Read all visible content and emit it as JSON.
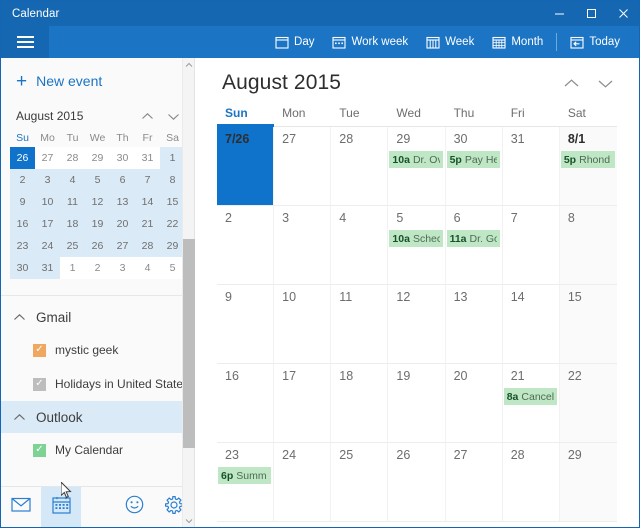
{
  "window": {
    "title": "Calendar",
    "controls": {
      "minimize": "minimize-icon",
      "maximize": "maximize-icon",
      "close": "close-icon"
    },
    "accent": "#1667b2",
    "command_bar_bg": "#1b74c4"
  },
  "command_bar": {
    "menu_icon": "hamburger-icon",
    "views": [
      {
        "label": "Day",
        "icon": "calendar-day-icon"
      },
      {
        "label": "Work week",
        "icon": "calendar-workweek-icon"
      },
      {
        "label": "Week",
        "icon": "calendar-week-icon"
      },
      {
        "label": "Month",
        "icon": "calendar-month-icon"
      }
    ],
    "today": {
      "label": "Today",
      "icon": "calendar-today-icon"
    }
  },
  "sidebar": {
    "new_event": {
      "label": "New event",
      "icon": "plus-icon"
    },
    "mini_calendar": {
      "title": "August 2015",
      "prev_icon": "chevron-up-icon",
      "next_icon": "chevron-down-icon",
      "day_headers": [
        "Su",
        "Mo",
        "Tu",
        "We",
        "Th",
        "Fr",
        "Sa"
      ],
      "weeks": [
        [
          {
            "d": "26",
            "in": false,
            "today": true
          },
          {
            "d": "27",
            "in": false,
            "today": false
          },
          {
            "d": "28",
            "in": false,
            "today": false
          },
          {
            "d": "29",
            "in": false,
            "today": false
          },
          {
            "d": "30",
            "in": false,
            "today": false
          },
          {
            "d": "31",
            "in": false,
            "today": false
          },
          {
            "d": "1",
            "in": true,
            "today": false
          }
        ],
        [
          {
            "d": "2",
            "in": true,
            "today": false
          },
          {
            "d": "3",
            "in": true,
            "today": false
          },
          {
            "d": "4",
            "in": true,
            "today": false
          },
          {
            "d": "5",
            "in": true,
            "today": false
          },
          {
            "d": "6",
            "in": true,
            "today": false
          },
          {
            "d": "7",
            "in": true,
            "today": false
          },
          {
            "d": "8",
            "in": true,
            "today": false
          }
        ],
        [
          {
            "d": "9",
            "in": true,
            "today": false
          },
          {
            "d": "10",
            "in": true,
            "today": false
          },
          {
            "d": "11",
            "in": true,
            "today": false
          },
          {
            "d": "12",
            "in": true,
            "today": false
          },
          {
            "d": "13",
            "in": true,
            "today": false
          },
          {
            "d": "14",
            "in": true,
            "today": false
          },
          {
            "d": "15",
            "in": true,
            "today": false
          }
        ],
        [
          {
            "d": "16",
            "in": true,
            "today": false
          },
          {
            "d": "17",
            "in": true,
            "today": false
          },
          {
            "d": "18",
            "in": true,
            "today": false
          },
          {
            "d": "19",
            "in": true,
            "today": false
          },
          {
            "d": "20",
            "in": true,
            "today": false
          },
          {
            "d": "21",
            "in": true,
            "today": false
          },
          {
            "d": "22",
            "in": true,
            "today": false
          }
        ],
        [
          {
            "d": "23",
            "in": true,
            "today": false
          },
          {
            "d": "24",
            "in": true,
            "today": false
          },
          {
            "d": "25",
            "in": true,
            "today": false
          },
          {
            "d": "26",
            "in": true,
            "today": false
          },
          {
            "d": "27",
            "in": true,
            "today": false
          },
          {
            "d": "28",
            "in": true,
            "today": false
          },
          {
            "d": "29",
            "in": true,
            "today": false
          }
        ],
        [
          {
            "d": "30",
            "in": true,
            "today": false
          },
          {
            "d": "31",
            "in": true,
            "today": false
          },
          {
            "d": "1",
            "in": false,
            "today": false
          },
          {
            "d": "2",
            "in": false,
            "today": false
          },
          {
            "d": "3",
            "in": false,
            "today": false
          },
          {
            "d": "4",
            "in": false,
            "today": false
          },
          {
            "d": "5",
            "in": false,
            "today": false
          }
        ]
      ]
    },
    "accounts": [
      {
        "name": "Gmail",
        "hovered": false,
        "calendars": [
          {
            "label": "mystic geek",
            "checked": true,
            "color": "#f0a860",
            "swatch": "orange"
          },
          {
            "label": "Holidays in United States",
            "checked": true,
            "color": "#bdbdbd",
            "swatch": "gray"
          }
        ]
      },
      {
        "name": "Outlook",
        "hovered": true,
        "calendars": [
          {
            "label": "My Calendar",
            "checked": true,
            "color": "#7ed394",
            "swatch": "green"
          }
        ]
      }
    ],
    "bottom_bar": [
      {
        "icon": "mail-icon",
        "active": false
      },
      {
        "icon": "calendar-icon",
        "active": true
      },
      {
        "icon": "feedback-smiley-icon",
        "active": false
      },
      {
        "icon": "settings-gear-icon",
        "active": false
      }
    ],
    "scrollbar": {
      "up_icon": "scroll-up-arrow",
      "down_icon": "scroll-down-arrow"
    }
  },
  "main": {
    "title": "August 2015",
    "prev_icon": "chevron-up-icon",
    "next_icon": "chevron-down-icon",
    "day_headers": [
      {
        "label": "Sun",
        "selected": true
      },
      {
        "label": "Mon",
        "selected": false
      },
      {
        "label": "Tue",
        "selected": false
      },
      {
        "label": "Wed",
        "selected": false
      },
      {
        "label": "Thu",
        "selected": false
      },
      {
        "label": "Fri",
        "selected": false
      },
      {
        "label": "Sat",
        "selected": false
      }
    ],
    "weeks": [
      [
        {
          "day": "7/26",
          "selected": true,
          "bold": true,
          "shade": false,
          "events": []
        },
        {
          "day": "27",
          "selected": false,
          "bold": false,
          "shade": false,
          "events": []
        },
        {
          "day": "28",
          "selected": false,
          "bold": false,
          "shade": false,
          "events": []
        },
        {
          "day": "29",
          "selected": false,
          "bold": false,
          "shade": false,
          "events": [
            {
              "time": "10a",
              "title": "Dr. Ov",
              "color": "#bfe7c5"
            }
          ]
        },
        {
          "day": "30",
          "selected": false,
          "bold": false,
          "shade": false,
          "events": [
            {
              "time": "5p",
              "title": "Pay He",
              "color": "#bfe7c5"
            }
          ]
        },
        {
          "day": "31",
          "selected": false,
          "bold": false,
          "shade": false,
          "events": []
        },
        {
          "day": "8/1",
          "selected": false,
          "bold": true,
          "shade": true,
          "events": [
            {
              "time": "5p",
              "title": "Rhond",
              "color": "#bfe7c5"
            }
          ]
        }
      ],
      [
        {
          "day": "2",
          "selected": false,
          "bold": false,
          "shade": false,
          "events": []
        },
        {
          "day": "3",
          "selected": false,
          "bold": false,
          "shade": false,
          "events": []
        },
        {
          "day": "4",
          "selected": false,
          "bold": false,
          "shade": false,
          "events": []
        },
        {
          "day": "5",
          "selected": false,
          "bold": false,
          "shade": false,
          "events": [
            {
              "time": "10a",
              "title": "Schec",
              "color": "#bfe7c5"
            }
          ]
        },
        {
          "day": "6",
          "selected": false,
          "bold": false,
          "shade": false,
          "events": [
            {
              "time": "11a",
              "title": "Dr. Go",
              "color": "#bfe7c5"
            }
          ]
        },
        {
          "day": "7",
          "selected": false,
          "bold": false,
          "shade": false,
          "events": []
        },
        {
          "day": "8",
          "selected": false,
          "bold": false,
          "shade": true,
          "events": []
        }
      ],
      [
        {
          "day": "9",
          "selected": false,
          "bold": false,
          "shade": false,
          "events": []
        },
        {
          "day": "10",
          "selected": false,
          "bold": false,
          "shade": false,
          "events": []
        },
        {
          "day": "11",
          "selected": false,
          "bold": false,
          "shade": false,
          "events": []
        },
        {
          "day": "12",
          "selected": false,
          "bold": false,
          "shade": false,
          "events": []
        },
        {
          "day": "13",
          "selected": false,
          "bold": false,
          "shade": false,
          "events": []
        },
        {
          "day": "14",
          "selected": false,
          "bold": false,
          "shade": false,
          "events": []
        },
        {
          "day": "15",
          "selected": false,
          "bold": false,
          "shade": true,
          "events": []
        }
      ],
      [
        {
          "day": "16",
          "selected": false,
          "bold": false,
          "shade": false,
          "events": []
        },
        {
          "day": "17",
          "selected": false,
          "bold": false,
          "shade": false,
          "events": []
        },
        {
          "day": "18",
          "selected": false,
          "bold": false,
          "shade": false,
          "events": []
        },
        {
          "day": "19",
          "selected": false,
          "bold": false,
          "shade": false,
          "events": []
        },
        {
          "day": "20",
          "selected": false,
          "bold": false,
          "shade": false,
          "events": []
        },
        {
          "day": "21",
          "selected": false,
          "bold": false,
          "shade": false,
          "events": [
            {
              "time": "8a",
              "title": "Cancel",
              "color": "#bfe7c5"
            }
          ]
        },
        {
          "day": "22",
          "selected": false,
          "bold": false,
          "shade": true,
          "events": []
        }
      ],
      [
        {
          "day": "23",
          "selected": false,
          "bold": false,
          "shade": false,
          "events": [
            {
              "time": "6p",
              "title": "Summ",
              "color": "#bfe7c5"
            }
          ]
        },
        {
          "day": "24",
          "selected": false,
          "bold": false,
          "shade": false,
          "events": []
        },
        {
          "day": "25",
          "selected": false,
          "bold": false,
          "shade": false,
          "events": []
        },
        {
          "day": "26",
          "selected": false,
          "bold": false,
          "shade": false,
          "events": []
        },
        {
          "day": "27",
          "selected": false,
          "bold": false,
          "shade": false,
          "events": []
        },
        {
          "day": "28",
          "selected": false,
          "bold": false,
          "shade": false,
          "events": []
        },
        {
          "day": "29",
          "selected": false,
          "bold": false,
          "shade": true,
          "events": []
        }
      ]
    ]
  }
}
